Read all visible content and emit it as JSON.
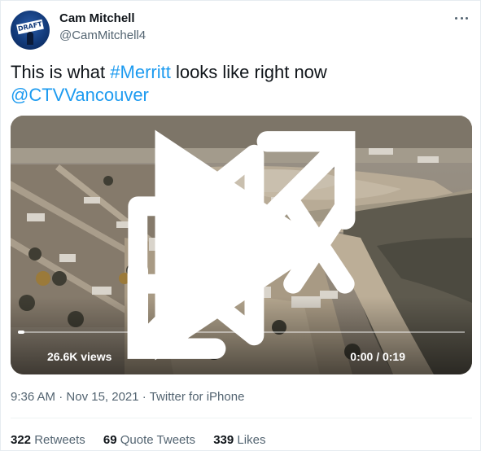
{
  "author": {
    "name": "Cam Mitchell",
    "handle": "@CamMitchell4",
    "avatar_text": "DRAFT"
  },
  "tweet": {
    "text_before": "This is what ",
    "hashtag": "#Merritt",
    "text_after": " looks like right now",
    "mention": "@CTVVancouver"
  },
  "video": {
    "views": "26.6K views",
    "time": "0:00 / 0:19",
    "progress_fraction": 0.0
  },
  "meta": {
    "time": "9:36 AM",
    "sep1": " · ",
    "date": "Nov 15, 2021",
    "sep2": " · ",
    "source": "Twitter for iPhone"
  },
  "stats": {
    "retweets_count": "322",
    "retweets_label": "Retweets",
    "quotes_count": "69",
    "quotes_label": "Quote Tweets",
    "likes_count": "339",
    "likes_label": "Likes"
  },
  "colors": {
    "link": "#1d9bf0",
    "text": "#0f1419",
    "secondary": "#536471"
  }
}
